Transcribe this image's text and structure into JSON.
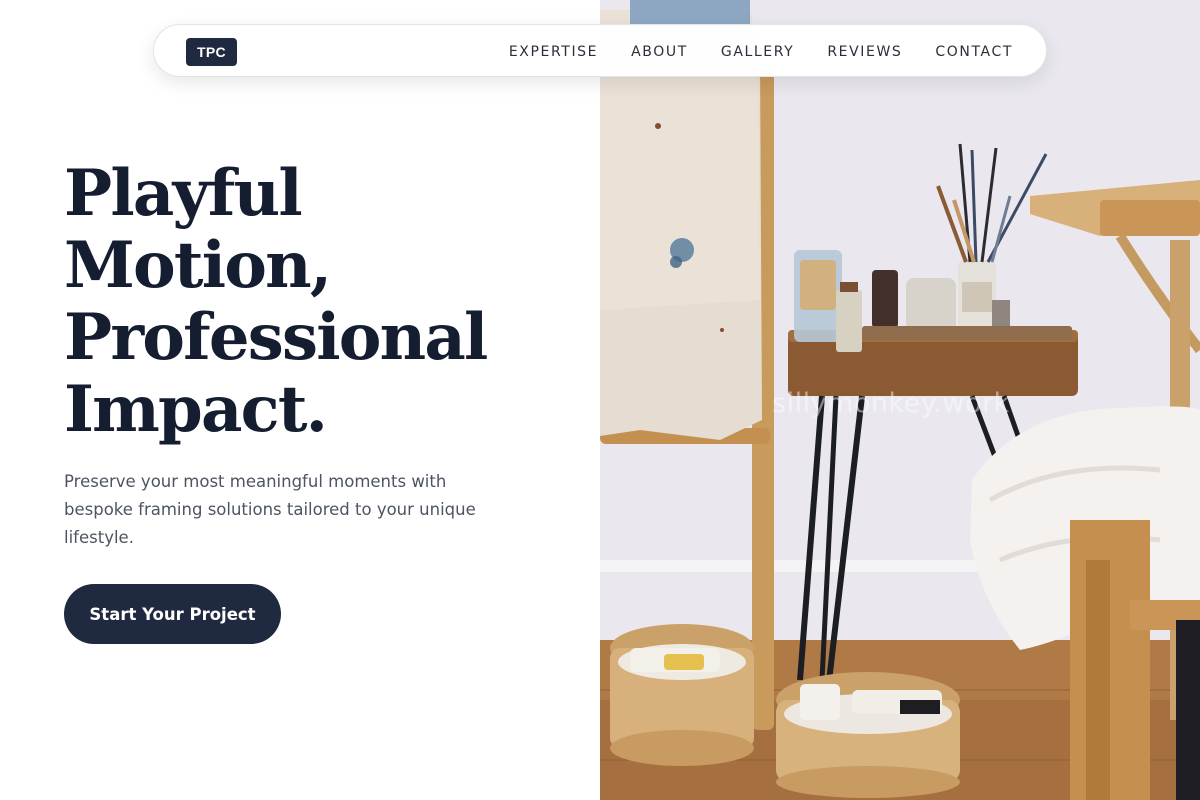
{
  "nav": {
    "logo": "TPC",
    "links": [
      "EXPERTISE",
      "ABOUT",
      "GALLERY",
      "REVIEWS",
      "CONTACT"
    ]
  },
  "hero": {
    "headline_lines": [
      "Playful",
      "Motion,",
      "Professional",
      "Impact."
    ],
    "subtext": "Preserve your most meaningful moments with bespoke framing solutions tailored to your unique lifestyle.",
    "cta_label": "Start Your Project"
  },
  "image": {
    "watermark": "sillymonkey.work",
    "alt": "art-studio-photo"
  },
  "colors": {
    "navy": "#1f2940",
    "headline": "#151d31",
    "body_text": "#4d5462",
    "background": "#ffffff"
  }
}
